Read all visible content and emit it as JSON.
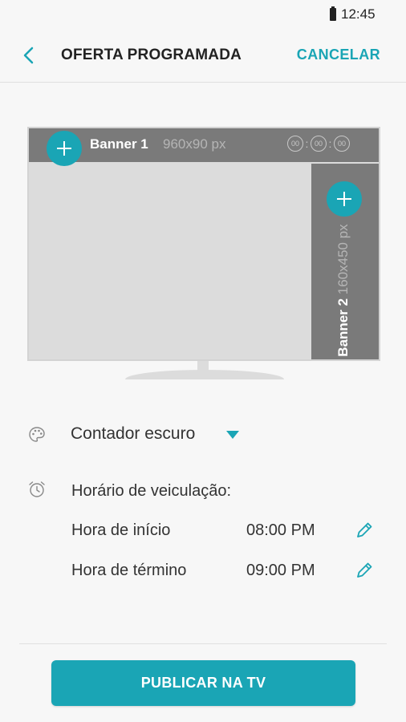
{
  "status_bar": {
    "time": "12:45"
  },
  "app_bar": {
    "title": "OFERTA PROGRAMADA",
    "cancel_label": "CANCELAR"
  },
  "preview": {
    "banner1": {
      "title": "Banner 1",
      "size": "960x90 px",
      "timer": [
        "00",
        "00",
        "00"
      ]
    },
    "banner2": {
      "title": "Banner 2",
      "size": "160x450 px"
    }
  },
  "theme": {
    "selected": "Contador escuro"
  },
  "schedule": {
    "title": "Horário de veiculação:",
    "start": {
      "label": "Hora de início",
      "time": "08:00 PM"
    },
    "end": {
      "label": "Hora de término",
      "time": "09:00 PM"
    }
  },
  "publish_label": "PUBLICAR NA TV",
  "colors": {
    "accent": "#1aa5b5",
    "banner_bg": "#7a7a7a",
    "screen_bg": "#dcdcdc"
  }
}
